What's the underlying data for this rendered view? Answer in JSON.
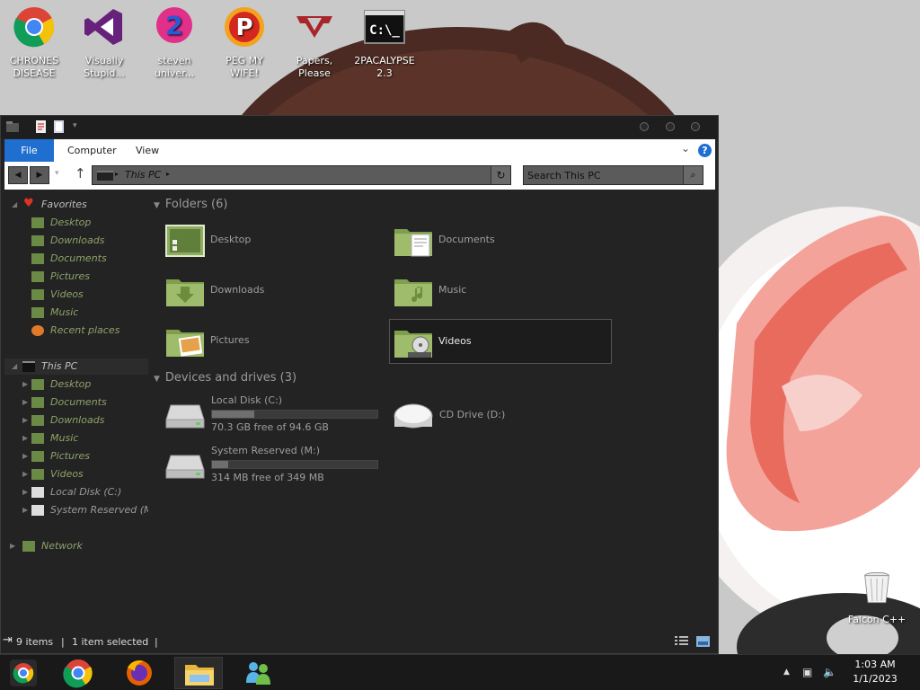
{
  "desktop": {
    "icons": [
      {
        "name": "chrome",
        "label_lines": [
          "CHRONES",
          "DISEASE"
        ]
      },
      {
        "name": "visual-studio",
        "label_lines": [
          "Visually",
          "Stupid..."
        ]
      },
      {
        "name": "steven-universe",
        "label_lines": [
          "steven",
          "univer..."
        ]
      },
      {
        "name": "peg-my-wife",
        "label_lines": [
          "PEG MY WIFE!",
          ""
        ]
      },
      {
        "name": "papers-please",
        "label_lines": [
          "Papers,",
          "Please"
        ]
      },
      {
        "name": "2pacalypse",
        "label_lines": [
          "2PACALYPSE",
          "2.3"
        ]
      }
    ],
    "recycle_bin": {
      "label": "Falcon C++"
    }
  },
  "window": {
    "ribbon": {
      "tabs": [
        "File",
        "Computer",
        "View"
      ],
      "help_label": "?"
    },
    "address": {
      "crumb": "This PC"
    },
    "search": {
      "placeholder": "Search This PC"
    },
    "nav": {
      "favorites": {
        "label": "Favorites",
        "items": [
          "Desktop",
          "Downloads",
          "Documents",
          "Pictures",
          "Videos",
          "Music",
          "Recent places"
        ]
      },
      "this_pc": {
        "label": "This PC",
        "items": [
          "Desktop",
          "Documents",
          "Downloads",
          "Music",
          "Pictures",
          "Videos",
          "Local Disk (C:)",
          "System Reserved (M:)"
        ]
      },
      "network": {
        "label": "Network"
      }
    },
    "folders_group": {
      "label": "Folders (6)",
      "items": [
        "Desktop",
        "Documents",
        "Downloads",
        "Music",
        "Pictures",
        "Videos"
      ],
      "selected": "Videos"
    },
    "drives_group": {
      "label": "Devices and drives (3)",
      "drives": [
        {
          "name": "Local Disk (C:)",
          "free_text": "70.3 GB free of 94.6 GB",
          "used_fraction": 0.257
        },
        {
          "name": "System Reserved (M:)",
          "free_text": "314 MB free of 349 MB",
          "used_fraction": 0.1
        }
      ],
      "cd": {
        "name": "CD Drive (D:)"
      }
    },
    "status": {
      "items": "9 items",
      "selected": "1 item selected",
      "separator": "|"
    }
  },
  "taskbar": {
    "time": "1:03 AM",
    "date": "1/1/2023"
  }
}
